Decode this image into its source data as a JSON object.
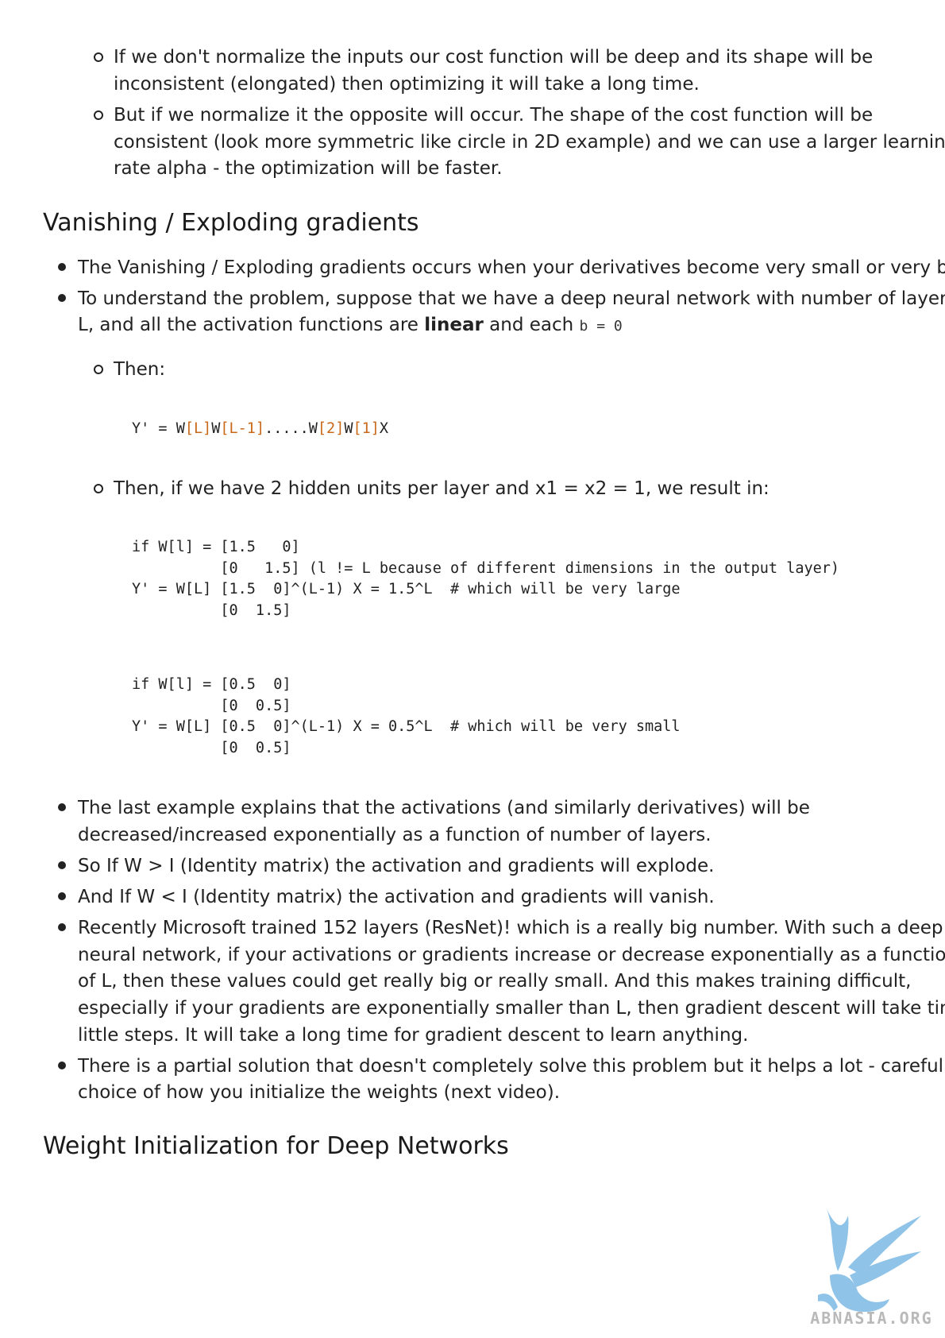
{
  "section1": {
    "bullets": [
      [
        "If we don't normalize the inputs our cost function will be deep and its shape will be",
        "inconsistent (elongated) then optimizing it will take a long time."
      ],
      [
        "But if we normalize it the opposite will occur. The shape of the cost function will be",
        "consistent (look more symmetric like circle in 2D example) and we can use a larger learning",
        "rate alpha - the optimization will be faster."
      ]
    ]
  },
  "section2": {
    "title": "Vanishing / Exploding gradients",
    "bullet1": "The Vanishing / Exploding gradients occurs when your derivatives become very small or very big.",
    "bullet2_line1": "To understand the problem, suppose that we have a deep neural network with number of layers",
    "bullet2_line2_pre": "L, and all the activation functions are ",
    "bullet2_line2_bold": "linear",
    "bullet2_line2_post": " and each ",
    "bullet2_code": "b = 0",
    "then_label": "Then:",
    "formula": {
      "p1": "Y' = W",
      "p2": "[L]",
      "p3": "W",
      "p4": "[L-1]",
      "p5": ".....W",
      "p6": "[2]",
      "p7": "W",
      "p8": "[1]",
      "p9": "X"
    },
    "then2_label": "Then, if we have 2 hidden units per layer and x1 = x2 = 1, we result in:",
    "code_block1": [
      "if W[l] = [1.5   0]",
      "          [0   1.5] (l != L because of different dimensions in the output layer)",
      "Y' = W[L] [1.5  0]^(L-1) X = 1.5^L  # which will be very large",
      "          [0  1.5]"
    ],
    "code_block2": [
      "if W[l] = [0.5  0]",
      "          [0  0.5]",
      "Y' = W[L] [0.5  0]^(L-1) X = 0.5^L  # which will be very small",
      "          [0  0.5]"
    ],
    "bullets_after": [
      [
        "The last example explains that the activations (and similarly derivatives) will be",
        "decreased/increased exponentially as a function of number of layers."
      ],
      [
        "So If W > I (Identity matrix) the activation and gradients will explode."
      ],
      [
        "And If W < I (Identity matrix) the activation and gradients will vanish."
      ],
      [
        "Recently Microsoft trained 152 layers (ResNet)! which is a really big number. With such a deep",
        "neural network, if your activations or gradients increase or decrease exponentially as a function",
        "of L, then these values could get really big or really small. And this makes training difficult,",
        "especially if your gradients are exponentially smaller than L, then gradient descent will take tiny",
        "little steps. It will take a long time for gradient descent to learn anything."
      ],
      [
        "There is a partial solution that doesn't completely solve this problem but it helps a lot - careful",
        "choice of how you initialize the weights (next video)."
      ]
    ]
  },
  "section3": {
    "title": "Weight Initialization for Deep Networks"
  },
  "watermark": {
    "text": "ABNASIA.ORG",
    "color": "#8fc3e8"
  }
}
